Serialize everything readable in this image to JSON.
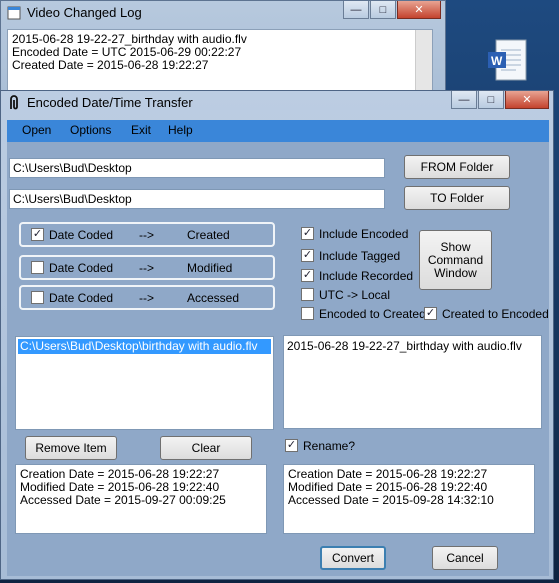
{
  "back_window": {
    "title": "Video Changed Log",
    "lines": [
      "2015-06-28 19-22-27_birthday with audio.flv",
      "Encoded Date = UTC 2015-06-29 00:22:27",
      "Created Date = 2015-06-28 19:22:27"
    ]
  },
  "main_window": {
    "title": "Encoded Date/Time Transfer",
    "menu": [
      "Open",
      "Options",
      "Exit",
      "Help"
    ]
  },
  "from_path": "C:\\Users\\Bud\\Desktop",
  "to_path": "C:\\Users\\Bud\\Desktop",
  "from_button": "FROM Folder",
  "to_button": "TO Folder",
  "mappings": [
    {
      "label": "Date Coded",
      "arrow": "-->",
      "target": "Created",
      "checked": true
    },
    {
      "label": "Date Coded",
      "arrow": "-->",
      "target": "Modified",
      "checked": false
    },
    {
      "label": "Date Coded",
      "arrow": "-->",
      "target": "Accessed",
      "checked": false
    }
  ],
  "options": [
    {
      "label": "Include Encoded",
      "checked": true
    },
    {
      "label": "Include Tagged",
      "checked": true
    },
    {
      "label": "Include Recorded",
      "checked": true
    },
    {
      "label": "UTC -> Local",
      "checked": false
    },
    {
      "label": "Encoded to Created",
      "checked": false
    },
    {
      "label": "Created to Encoded",
      "checked": true
    }
  ],
  "show_command_window": "Show Command Window",
  "source_list": [
    "C:\\Users\\Bud\\Desktop\\birthday with audio.flv"
  ],
  "target_list": [
    "2015-06-28 19-22-27_birthday with audio.flv"
  ],
  "remove_item": "Remove Item",
  "clear": "Clear",
  "rename": {
    "label": "Rename?",
    "checked": true
  },
  "source_dates": [
    "Creation Date = 2015-06-28 19:22:27",
    "Modified Date = 2015-06-28 19:22:40",
    "Accessed Date = 2015-09-27 00:09:25"
  ],
  "target_dates": [
    "Creation Date = 2015-06-28 19:22:27",
    "Modified Date = 2015-06-28 19:22:40",
    "Accessed Date = 2015-09-28 14:32:10"
  ],
  "convert": "Convert",
  "cancel": "Cancel",
  "window_controls": {
    "minimize": "—",
    "maximize": "□",
    "close": "✕"
  },
  "check_glyph": "✓",
  "colors": {
    "menubar": "#3a86d9",
    "selection": "#3399ff",
    "client": "#8fa8c8"
  }
}
